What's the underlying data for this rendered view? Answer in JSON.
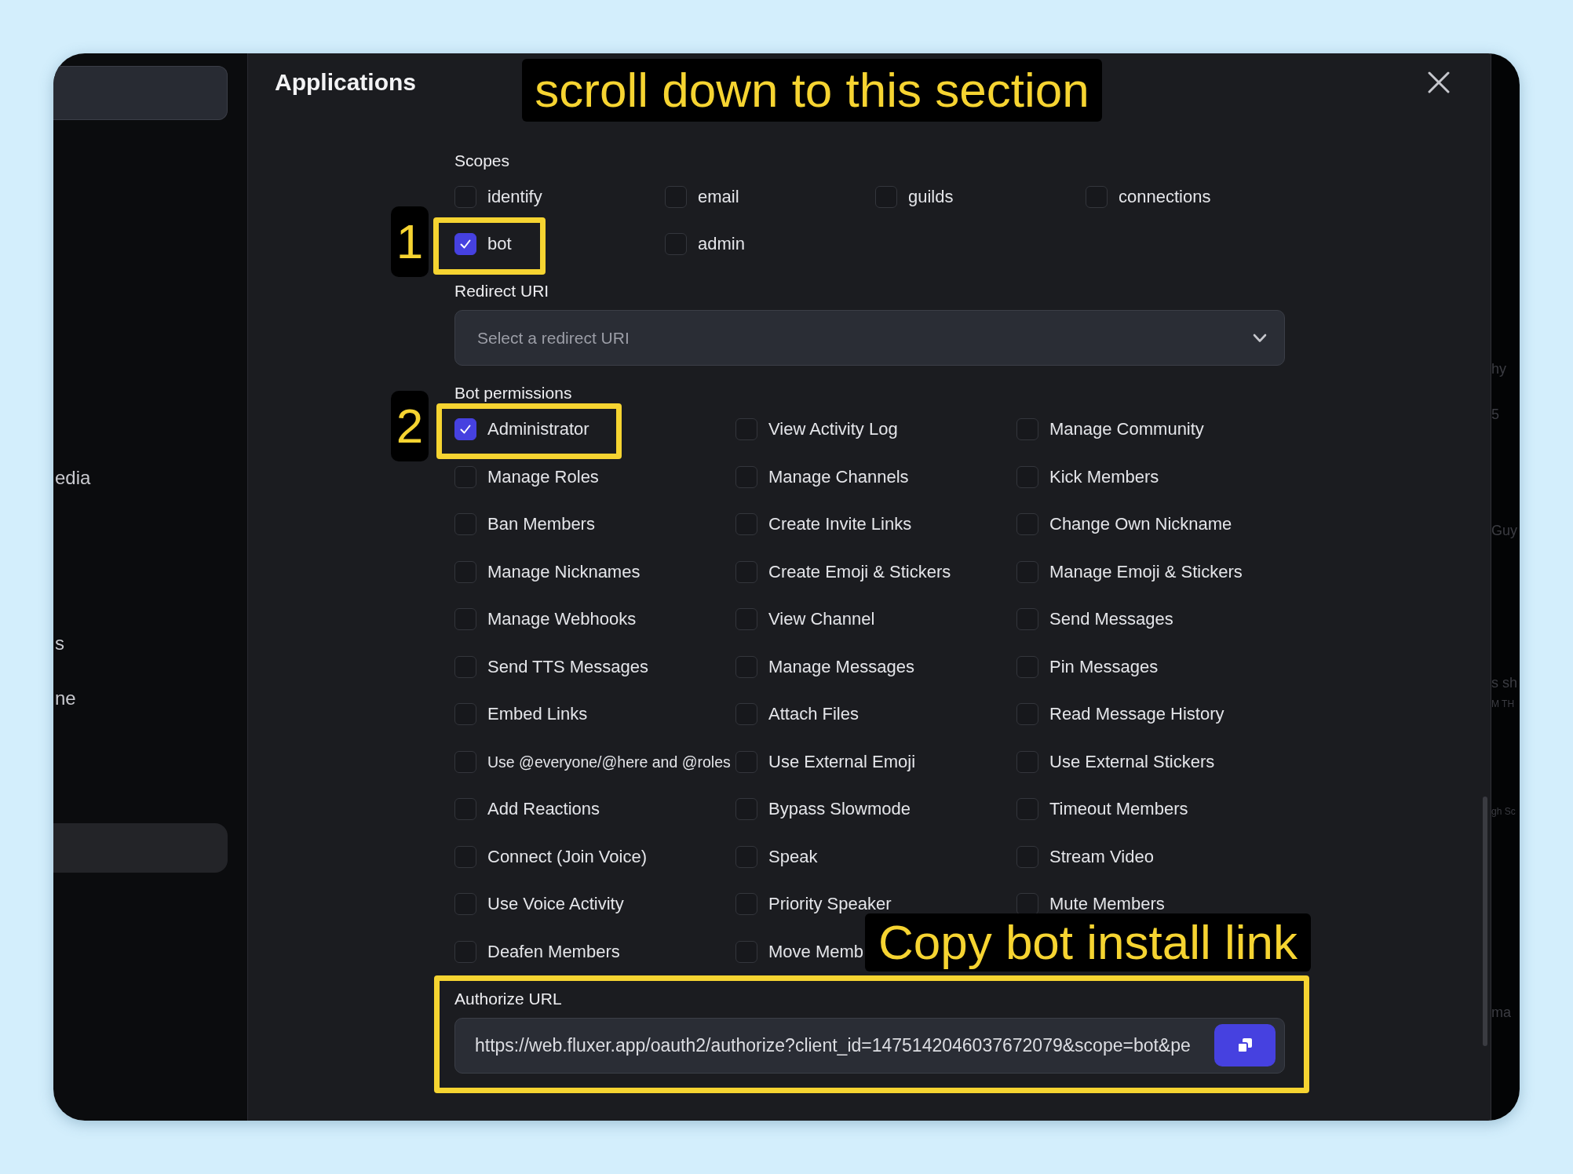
{
  "sidebar": {
    "items": [
      "edia",
      "s",
      "ne"
    ]
  },
  "background_window": {
    "texts": [
      {
        "text": "hy",
        "kind": "large"
      },
      {
        "text": "5",
        "kind": "large"
      },
      {
        "text": "Guy",
        "kind": "large"
      },
      {
        "text": "s sh",
        "kind": "large"
      },
      {
        "text": "M TH",
        "kind": "small"
      },
      {
        "text": "gh Sc",
        "kind": "small"
      },
      {
        "text": "ma",
        "kind": "large"
      }
    ]
  },
  "modal": {
    "title": "Applications",
    "scopes": {
      "label": "Scopes",
      "items": [
        {
          "label": "identify",
          "checked": false
        },
        {
          "label": "email",
          "checked": false
        },
        {
          "label": "guilds",
          "checked": false
        },
        {
          "label": "connections",
          "checked": false
        },
        {
          "label": "bot",
          "checked": true
        },
        {
          "label": "admin",
          "checked": false
        }
      ]
    },
    "redirect_uri": {
      "label": "Redirect URI",
      "placeholder": "Select a redirect URI"
    },
    "bot_permissions": {
      "label": "Bot permissions",
      "items": [
        {
          "label": "Administrator",
          "checked": true
        },
        {
          "label": "View Activity Log",
          "checked": false
        },
        {
          "label": "Manage Community",
          "checked": false
        },
        {
          "label": "Manage Roles",
          "checked": false
        },
        {
          "label": "Manage Channels",
          "checked": false
        },
        {
          "label": "Kick Members",
          "checked": false
        },
        {
          "label": "Ban Members",
          "checked": false
        },
        {
          "label": "Create Invite Links",
          "checked": false
        },
        {
          "label": "Change Own Nickname",
          "checked": false
        },
        {
          "label": "Manage Nicknames",
          "checked": false
        },
        {
          "label": "Create Emoji & Stickers",
          "checked": false
        },
        {
          "label": "Manage Emoji & Stickers",
          "checked": false
        },
        {
          "label": "Manage Webhooks",
          "checked": false
        },
        {
          "label": "View Channel",
          "checked": false
        },
        {
          "label": "Send Messages",
          "checked": false
        },
        {
          "label": "Send TTS Messages",
          "checked": false
        },
        {
          "label": "Manage Messages",
          "checked": false
        },
        {
          "label": "Pin Messages",
          "checked": false
        },
        {
          "label": "Embed Links",
          "checked": false
        },
        {
          "label": "Attach Files",
          "checked": false
        },
        {
          "label": "Read Message History",
          "checked": false
        },
        {
          "label": "Use @everyone/@here and @roles",
          "checked": false
        },
        {
          "label": "Use External Emoji",
          "checked": false
        },
        {
          "label": "Use External Stickers",
          "checked": false
        },
        {
          "label": "Add Reactions",
          "checked": false
        },
        {
          "label": "Bypass Slowmode",
          "checked": false
        },
        {
          "label": "Timeout Members",
          "checked": false
        },
        {
          "label": "Connect (Join Voice)",
          "checked": false
        },
        {
          "label": "Speak",
          "checked": false
        },
        {
          "label": "Stream Video",
          "checked": false
        },
        {
          "label": "Use Voice Activity",
          "checked": false
        },
        {
          "label": "Priority Speaker",
          "checked": false
        },
        {
          "label": "Mute Members",
          "checked": false
        },
        {
          "label": "Deafen Members",
          "checked": false
        },
        {
          "label": "Move Memb",
          "checked": false
        }
      ]
    },
    "authorize_url": {
      "label": "Authorize URL",
      "value": "https://web.fluxer.app/oauth2/authorize?client_id=1475142046037672079&scope=bot&pe"
    }
  },
  "annotations": [
    {
      "kind": "caption",
      "text": "scroll down to this section"
    },
    {
      "kind": "step",
      "text": "1"
    },
    {
      "kind": "step",
      "text": "2"
    },
    {
      "kind": "caption",
      "text": "Copy bot install link"
    }
  ]
}
